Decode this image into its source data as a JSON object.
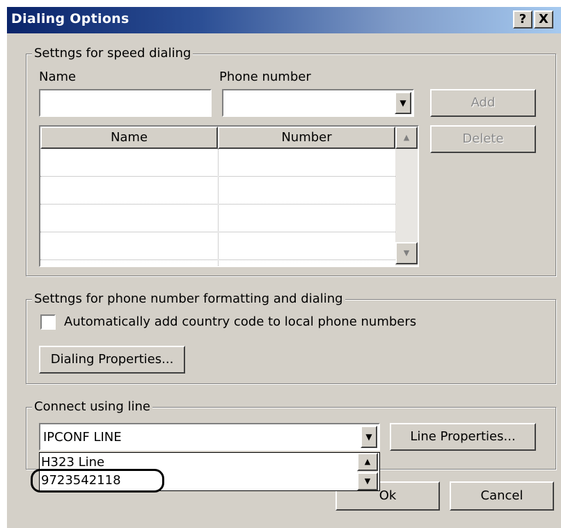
{
  "window": {
    "title": "Dialing Options",
    "help_button": "?",
    "close_button": "X"
  },
  "speed_dialing": {
    "group_label": "Settngs for speed dialing",
    "name_label": "Name",
    "phone_label": "Phone number",
    "name_value": "",
    "phone_value": "",
    "add_button": "Add",
    "delete_button": "Delete",
    "columns": [
      "Name",
      "Number"
    ],
    "rows": [
      {
        "name": "",
        "number": ""
      },
      {
        "name": "",
        "number": ""
      },
      {
        "name": "",
        "number": ""
      },
      {
        "name": "",
        "number": ""
      }
    ]
  },
  "formatting": {
    "group_label": "Settngs for phone number formatting and dialing",
    "checkbox_label": "Automatically add country code to local phone numbers",
    "checkbox_checked": false,
    "dialing_properties_button": "Dialing Properties..."
  },
  "connect": {
    "group_label": "Connect using line",
    "selected_line": "IPCONF LINE",
    "line_properties_button": "Line Properties...",
    "dropdown_options": [
      "H323 Line",
      "9723542118"
    ]
  },
  "footer": {
    "ok_button": "Ok",
    "cancel_button": "Cancel"
  },
  "colors": {
    "dialog_face": "#d4d0c8",
    "titlebar_start": "#0a246a",
    "titlebar_end": "#a6caf0"
  },
  "icons": {
    "combo_arrow": "▼",
    "scroll_up": "▲",
    "scroll_down": "▼"
  }
}
